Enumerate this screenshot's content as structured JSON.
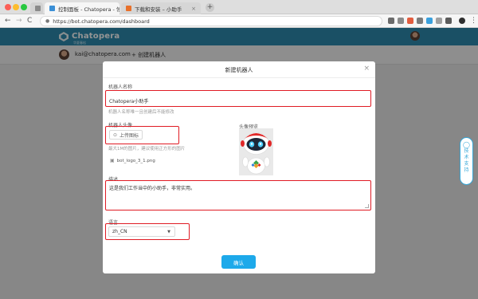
{
  "browser": {
    "tabs": [
      {
        "label": "",
        "active": false,
        "favicon_color": "#8a8a8a"
      },
      {
        "label": "控制面板 - Chatopera - 领先的...",
        "active": true,
        "favicon_color": "#3b8fd6"
      },
      {
        "label": "下载和安装 – 小助手",
        "active": false,
        "favicon_color": "#e8702a"
      }
    ],
    "new_tab_symbol": "+",
    "address": "https://bot.chatopera.com/dashboard",
    "nav": {
      "back": "←",
      "forward": "→",
      "reload": "C",
      "lock": "🔒"
    },
    "extension_colors": [
      "#6b6b6b",
      "#8a8a8a",
      "#e35d3f",
      "#7b7b7b",
      "#3aa0dd",
      "#a0a0a0",
      "#5b5b5b",
      "#2f2f2f"
    ]
  },
  "app": {
    "brand": "Chatopera",
    "brand_sub": "华夏春松",
    "header_color": "#2e8bae",
    "user_email": "kai@chatopera.com",
    "create_bot_link": "+ 创建机器人"
  },
  "support_widget": {
    "icon": "💬",
    "label": "技术支持"
  },
  "modal": {
    "title": "新建机器人",
    "close_symbol": "×",
    "name_label": "机器人名称",
    "name_value": "Chatopera小助手",
    "name_hint": "机器人名称唯一且创建后不能修改",
    "avatar_label": "机器人头像",
    "upload_label": "上传图标",
    "upload_hint": "最大1M的图片，建议使用正方形的图片",
    "file_name": "bot_logo_3_1.png",
    "preview_label": "头像预览",
    "desc_label": "描述",
    "desc_value": "这是我们工作当中的小助手，非常实用。",
    "lang_label": "语言",
    "lang_value": "zh_CN",
    "confirm_label": "确认",
    "highlight_color": "#e01b24",
    "primary_color": "#1da9ea"
  }
}
